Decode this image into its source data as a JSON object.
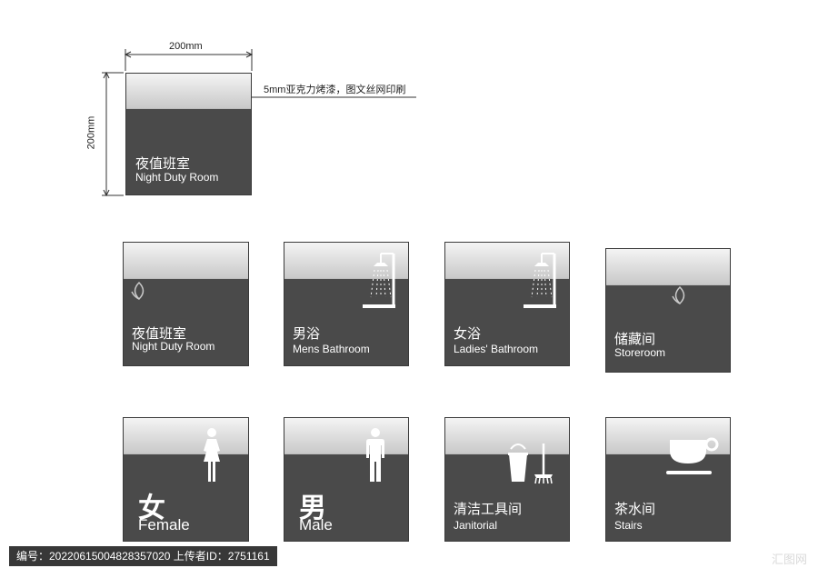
{
  "spec": {
    "width_label": "200mm",
    "height_label": "200mm",
    "material_note": "5mm亚克力烤漆，图文丝网印刷"
  },
  "signs": {
    "sample": {
      "cn": "夜值班室",
      "en": "Night Duty  Room"
    },
    "night_duty": {
      "cn": "夜值班室",
      "en": "Night Duty  Room"
    },
    "mens_bathroom": {
      "cn": "男浴",
      "en": "Mens Bathroom"
    },
    "ladies_bathroom": {
      "cn": "女浴",
      "en": "Ladies' Bathroom"
    },
    "storeroom": {
      "cn": "储藏间",
      "en": "Storeroom"
    },
    "female": {
      "cn": "女",
      "en": "Female"
    },
    "male": {
      "cn": "男",
      "en": "Male"
    },
    "janitorial": {
      "cn": "清洁工具间",
      "en": "Janitorial"
    },
    "stairs": {
      "cn": "茶水间",
      "en": "Stairs"
    }
  },
  "footer": {
    "info": "编号：20220615004828357020 上传者ID：2751161",
    "watermark": "汇图网"
  },
  "colors": {
    "panel": "#4a4a4a",
    "top_band": "#dcdcdc",
    "text": "#ffffff"
  }
}
